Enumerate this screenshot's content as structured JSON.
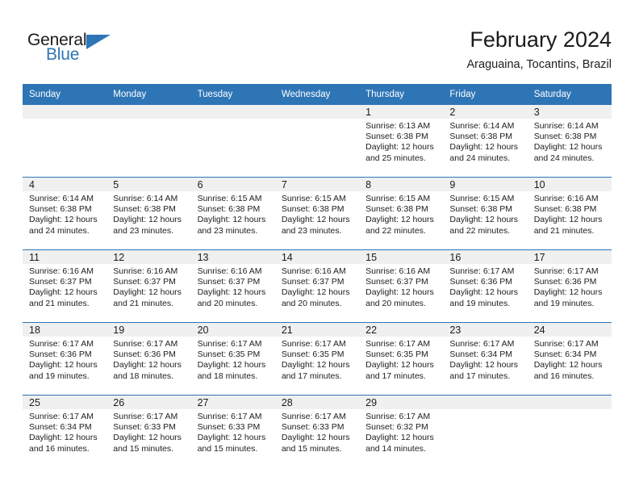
{
  "brand": {
    "name_top": "General",
    "name_bottom": "Blue",
    "accent_color": "#2E75B6",
    "triangle_icon": "brand-triangle-icon"
  },
  "header": {
    "month_title": "February 2024",
    "location": "Araguaina, Tocantins, Brazil"
  },
  "calendar": {
    "weekday_headers": [
      "Sunday",
      "Monday",
      "Tuesday",
      "Wednesday",
      "Thursday",
      "Friday",
      "Saturday"
    ],
    "header_bg": "#2E75B6",
    "daynum_band_bg": "#F0F0F0",
    "weeks": [
      [
        {
          "day": "",
          "empty": true
        },
        {
          "day": "",
          "empty": true
        },
        {
          "day": "",
          "empty": true
        },
        {
          "day": "",
          "empty": true
        },
        {
          "day": "1",
          "sunrise": "Sunrise: 6:13 AM",
          "sunset": "Sunset: 6:38 PM",
          "daylight": "Daylight: 12 hours and 25 minutes."
        },
        {
          "day": "2",
          "sunrise": "Sunrise: 6:14 AM",
          "sunset": "Sunset: 6:38 PM",
          "daylight": "Daylight: 12 hours and 24 minutes."
        },
        {
          "day": "3",
          "sunrise": "Sunrise: 6:14 AM",
          "sunset": "Sunset: 6:38 PM",
          "daylight": "Daylight: 12 hours and 24 minutes."
        }
      ],
      [
        {
          "day": "4",
          "sunrise": "Sunrise: 6:14 AM",
          "sunset": "Sunset: 6:38 PM",
          "daylight": "Daylight: 12 hours and 24 minutes."
        },
        {
          "day": "5",
          "sunrise": "Sunrise: 6:14 AM",
          "sunset": "Sunset: 6:38 PM",
          "daylight": "Daylight: 12 hours and 23 minutes."
        },
        {
          "day": "6",
          "sunrise": "Sunrise: 6:15 AM",
          "sunset": "Sunset: 6:38 PM",
          "daylight": "Daylight: 12 hours and 23 minutes."
        },
        {
          "day": "7",
          "sunrise": "Sunrise: 6:15 AM",
          "sunset": "Sunset: 6:38 PM",
          "daylight": "Daylight: 12 hours and 23 minutes."
        },
        {
          "day": "8",
          "sunrise": "Sunrise: 6:15 AM",
          "sunset": "Sunset: 6:38 PM",
          "daylight": "Daylight: 12 hours and 22 minutes."
        },
        {
          "day": "9",
          "sunrise": "Sunrise: 6:15 AM",
          "sunset": "Sunset: 6:38 PM",
          "daylight": "Daylight: 12 hours and 22 minutes."
        },
        {
          "day": "10",
          "sunrise": "Sunrise: 6:16 AM",
          "sunset": "Sunset: 6:38 PM",
          "daylight": "Daylight: 12 hours and 21 minutes."
        }
      ],
      [
        {
          "day": "11",
          "sunrise": "Sunrise: 6:16 AM",
          "sunset": "Sunset: 6:37 PM",
          "daylight": "Daylight: 12 hours and 21 minutes."
        },
        {
          "day": "12",
          "sunrise": "Sunrise: 6:16 AM",
          "sunset": "Sunset: 6:37 PM",
          "daylight": "Daylight: 12 hours and 21 minutes."
        },
        {
          "day": "13",
          "sunrise": "Sunrise: 6:16 AM",
          "sunset": "Sunset: 6:37 PM",
          "daylight": "Daylight: 12 hours and 20 minutes."
        },
        {
          "day": "14",
          "sunrise": "Sunrise: 6:16 AM",
          "sunset": "Sunset: 6:37 PM",
          "daylight": "Daylight: 12 hours and 20 minutes."
        },
        {
          "day": "15",
          "sunrise": "Sunrise: 6:16 AM",
          "sunset": "Sunset: 6:37 PM",
          "daylight": "Daylight: 12 hours and 20 minutes."
        },
        {
          "day": "16",
          "sunrise": "Sunrise: 6:17 AM",
          "sunset": "Sunset: 6:36 PM",
          "daylight": "Daylight: 12 hours and 19 minutes."
        },
        {
          "day": "17",
          "sunrise": "Sunrise: 6:17 AM",
          "sunset": "Sunset: 6:36 PM",
          "daylight": "Daylight: 12 hours and 19 minutes."
        }
      ],
      [
        {
          "day": "18",
          "sunrise": "Sunrise: 6:17 AM",
          "sunset": "Sunset: 6:36 PM",
          "daylight": "Daylight: 12 hours and 19 minutes."
        },
        {
          "day": "19",
          "sunrise": "Sunrise: 6:17 AM",
          "sunset": "Sunset: 6:36 PM",
          "daylight": "Daylight: 12 hours and 18 minutes."
        },
        {
          "day": "20",
          "sunrise": "Sunrise: 6:17 AM",
          "sunset": "Sunset: 6:35 PM",
          "daylight": "Daylight: 12 hours and 18 minutes."
        },
        {
          "day": "21",
          "sunrise": "Sunrise: 6:17 AM",
          "sunset": "Sunset: 6:35 PM",
          "daylight": "Daylight: 12 hours and 17 minutes."
        },
        {
          "day": "22",
          "sunrise": "Sunrise: 6:17 AM",
          "sunset": "Sunset: 6:35 PM",
          "daylight": "Daylight: 12 hours and 17 minutes."
        },
        {
          "day": "23",
          "sunrise": "Sunrise: 6:17 AM",
          "sunset": "Sunset: 6:34 PM",
          "daylight": "Daylight: 12 hours and 17 minutes."
        },
        {
          "day": "24",
          "sunrise": "Sunrise: 6:17 AM",
          "sunset": "Sunset: 6:34 PM",
          "daylight": "Daylight: 12 hours and 16 minutes."
        }
      ],
      [
        {
          "day": "25",
          "sunrise": "Sunrise: 6:17 AM",
          "sunset": "Sunset: 6:34 PM",
          "daylight": "Daylight: 12 hours and 16 minutes."
        },
        {
          "day": "26",
          "sunrise": "Sunrise: 6:17 AM",
          "sunset": "Sunset: 6:33 PM",
          "daylight": "Daylight: 12 hours and 15 minutes."
        },
        {
          "day": "27",
          "sunrise": "Sunrise: 6:17 AM",
          "sunset": "Sunset: 6:33 PM",
          "daylight": "Daylight: 12 hours and 15 minutes."
        },
        {
          "day": "28",
          "sunrise": "Sunrise: 6:17 AM",
          "sunset": "Sunset: 6:33 PM",
          "daylight": "Daylight: 12 hours and 15 minutes."
        },
        {
          "day": "29",
          "sunrise": "Sunrise: 6:17 AM",
          "sunset": "Sunset: 6:32 PM",
          "daylight": "Daylight: 12 hours and 14 minutes."
        },
        {
          "day": "",
          "empty": true
        },
        {
          "day": "",
          "empty": true
        }
      ]
    ]
  }
}
